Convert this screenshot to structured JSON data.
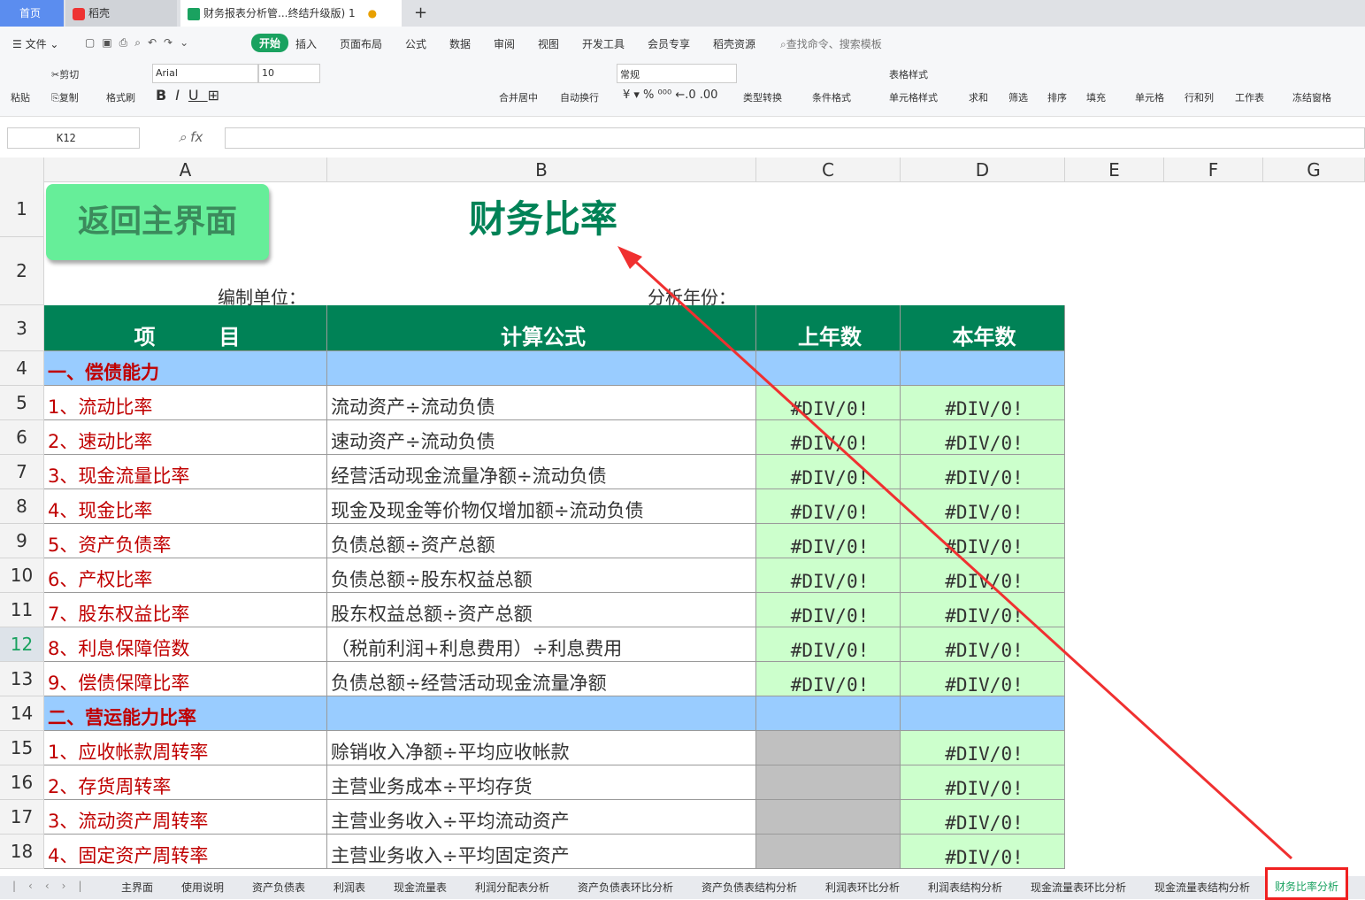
{
  "window_tabs": [
    {
      "label": "首页"
    },
    {
      "label": "稻壳"
    },
    {
      "label": "财务报表分析管...终结升级版) 1"
    }
  ],
  "menu": {
    "file": "文件",
    "items": [
      "开始",
      "插入",
      "页面布局",
      "公式",
      "数据",
      "审阅",
      "视图",
      "开发工具",
      "会员专享",
      "稻壳资源"
    ],
    "search": "查找命令、搜索模板"
  },
  "ribbon": {
    "paste": "粘贴",
    "cut": "剪切",
    "copy": "复制",
    "format_painter": "格式刷",
    "font": "Arial",
    "size": "10",
    "merge": "合并居中",
    "wrap": "自动换行",
    "number_format": "常规",
    "convert": "类型转换",
    "cond_format": "条件格式",
    "table_style": "表格样式",
    "cell_style": "单元格样式",
    "sum": "求和",
    "filter": "筛选",
    "sort": "排序",
    "fill": "填充",
    "cell": "单元格",
    "rowcol": "行和列",
    "sheet": "工作表",
    "freeze": "冻结窗格"
  },
  "formula_bar": {
    "name_box": "K12",
    "fx": "fx",
    "value": ""
  },
  "columns": [
    "A",
    "B",
    "C",
    "D",
    "E",
    "F",
    "G"
  ],
  "rows": [
    "1",
    "2",
    "3",
    "4",
    "5",
    "6",
    "7",
    "8",
    "9",
    "10",
    "11",
    "12",
    "13",
    "14",
    "15",
    "16",
    "17",
    "18"
  ],
  "selected_row": "12",
  "sheet": {
    "back_button": "返回主界面",
    "title": "财务比率",
    "unit_label": "编制单位：",
    "year_label": "分析年份：",
    "headers": [
      "项　　　目",
      "计算公式",
      "上年数",
      "本年数"
    ],
    "sections": [
      {
        "title": "一、偿债能力",
        "items": [
          [
            "1、流动比率",
            "流动资产÷流动负债",
            "#DIV/0!",
            "#DIV/0!"
          ],
          [
            "2、速动比率",
            "速动资产÷流动负债",
            "#DIV/0!",
            "#DIV/0!"
          ],
          [
            "3、现金流量比率",
            "经营活动现金流量净额÷流动负债",
            "#DIV/0!",
            "#DIV/0!"
          ],
          [
            "4、现金比率",
            "现金及现金等价物仅增加额÷流动负债",
            "#DIV/0!",
            "#DIV/0!"
          ],
          [
            "5、资产负债率",
            "负债总额÷资产总额",
            "#DIV/0!",
            "#DIV/0!"
          ],
          [
            "6、产权比率",
            "负债总额÷股东权益总额",
            "#DIV/0!",
            "#DIV/0!"
          ],
          [
            "7、股东权益比率",
            "股东权益总额÷资产总额",
            "#DIV/0!",
            "#DIV/0!"
          ],
          [
            "8、利息保障倍数",
            "（税前利润+利息费用）÷利息费用",
            "#DIV/0!",
            "#DIV/0!"
          ],
          [
            "9、偿债保障比率",
            "负债总额÷经营活动现金流量净额",
            "#DIV/0!",
            "#DIV/0!"
          ]
        ]
      },
      {
        "title": "二、营运能力比率",
        "items": [
          [
            "1、应收帐款周转率",
            "赊销收入净额÷平均应收帐款",
            "",
            "#DIV/0!"
          ],
          [
            "2、存货周转率",
            "主营业务成本÷平均存货",
            "",
            "#DIV/0!"
          ],
          [
            "3、流动资产周转率",
            "主营业务收入÷平均流动资产",
            "",
            "#DIV/0!"
          ],
          [
            "4、固定资产周转率",
            "主营业务收入÷平均固定资产",
            "",
            "#DIV/0!"
          ]
        ]
      }
    ]
  },
  "sheet_tabs": [
    "主界面",
    "使用说明",
    "资产负债表",
    "利润表",
    "现金流量表",
    "利润分配表分析",
    "资产负债表环比分析",
    "资产负债表结构分析",
    "利润表环比分析",
    "利润表结构分析",
    "现金流量表环比分析",
    "现金流量表结构分析",
    "财务比率分析"
  ],
  "active_sheet": "财务比率分析",
  "colors": {
    "header_green": "#008256",
    "section_blue": "#99ccff",
    "value_green": "#ccffcc",
    "gray": "#c0c0c0",
    "red_text": "#c00000",
    "button_green": "#66ee99",
    "annotation_red": "#f03030"
  }
}
